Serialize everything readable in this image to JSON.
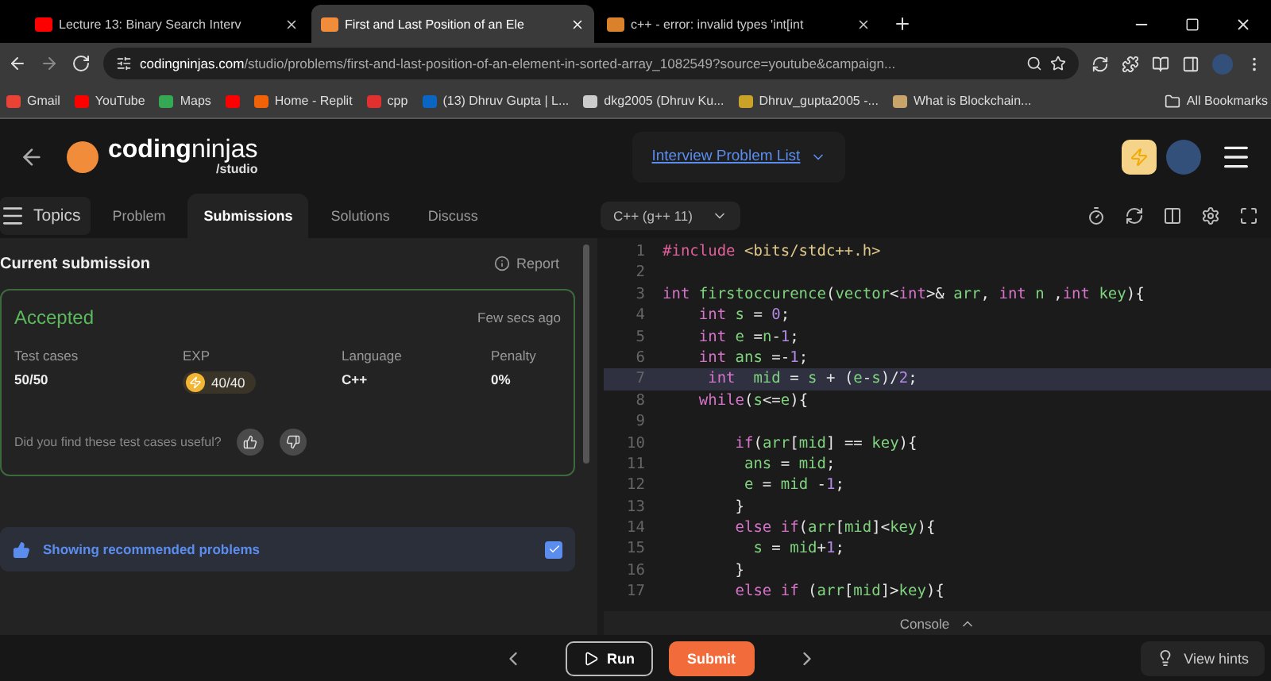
{
  "browser": {
    "tabs": [
      {
        "title": "Lecture 13: Binary Search Interv",
        "selected": false
      },
      {
        "title": "First and Last Position of an Ele",
        "selected": true
      },
      {
        "title": "c++ - error: invalid types 'int[int",
        "selected": false
      }
    ],
    "url_domain": "codingninjas.com",
    "url_path": "/studio/problems/first-and-last-position-of-an-element-in-sorted-array_1082549?source=youtube&campaign...",
    "bookmarks": [
      {
        "kind": "labeled",
        "label": "Gmail"
      },
      {
        "kind": "labeled",
        "label": "YouTube"
      },
      {
        "kind": "labeled",
        "label": "Maps"
      },
      {
        "kind": "icon"
      },
      {
        "kind": "labeled",
        "label": "Home - Replit"
      },
      {
        "kind": "labeled",
        "label": "cpp"
      },
      {
        "kind": "labeled",
        "label": "(13) Dhruv Gupta | L..."
      },
      {
        "kind": "labeled",
        "label": "dkg2005 (Dhruv Ku..."
      },
      {
        "kind": "labeled",
        "label": "Dhruv_gupta2005 -..."
      },
      {
        "kind": "labeled",
        "label": "What is Blockchain..."
      }
    ],
    "all_bookmarks": "All Bookmarks"
  },
  "header": {
    "logo_bold": "coding",
    "logo_light": "ninjas",
    "logo_sub": "/studio",
    "problem_list": "Interview Problem List"
  },
  "nav": {
    "topics": "Topics",
    "tabs": [
      {
        "label": "Problem",
        "selected": false
      },
      {
        "label": "Submissions",
        "selected": true
      },
      {
        "label": "Solutions",
        "selected": false
      },
      {
        "label": "Discuss",
        "selected": false
      }
    ]
  },
  "submission": {
    "title": "Current submission",
    "report": "Report",
    "status": "Accepted",
    "time": "Few secs ago",
    "stats": [
      {
        "label": "Test cases",
        "value": "50/50",
        "kind": "text"
      },
      {
        "label": "EXP",
        "value": "40/40",
        "kind": "exp"
      },
      {
        "label": "Language",
        "value": "C++",
        "kind": "text"
      },
      {
        "label": "Penalty",
        "value": "0%",
        "kind": "text"
      }
    ],
    "feedback": "Did you find these test cases useful?"
  },
  "recommended": {
    "label": "Showing recommended problems",
    "checked": true
  },
  "editor": {
    "language": "C++ (g++ 11)",
    "lines": [
      {
        "n": "1",
        "highlighted": false,
        "tokens": [
          {
            "kind": "pre",
            "text": "#include "
          },
          {
            "kind": "str",
            "text": "<bits/stdc++.h>"
          }
        ]
      },
      {
        "n": "2",
        "highlighted": false
      },
      {
        "n": "3",
        "highlighted": false,
        "tokens": [
          {
            "kind": "kw",
            "text": "int "
          },
          {
            "kind": "id",
            "text": "firstoccurence"
          },
          {
            "kind": "p",
            "text": "("
          },
          {
            "kind": "id",
            "text": "vector"
          },
          {
            "kind": "p",
            "text": "<"
          },
          {
            "kind": "kw",
            "text": "int"
          },
          {
            "kind": "p",
            "text": ">& "
          },
          {
            "kind": "id",
            "text": "arr"
          },
          {
            "kind": "p",
            "text": ", "
          },
          {
            "kind": "kw",
            "text": "int "
          },
          {
            "kind": "id",
            "text": "n "
          },
          {
            "kind": "p",
            "text": ","
          },
          {
            "kind": "kw",
            "text": "int "
          },
          {
            "kind": "id",
            "text": "key"
          },
          {
            "kind": "p",
            "text": "){"
          }
        ]
      },
      {
        "n": "4",
        "highlighted": false,
        "tokens": [
          {
            "kind": "kw",
            "text": "    int "
          },
          {
            "kind": "id",
            "text": "s "
          },
          {
            "kind": "p",
            "text": "= "
          },
          {
            "kind": "num",
            "text": "0"
          },
          {
            "kind": "p",
            "text": ";"
          }
        ]
      },
      {
        "n": "5",
        "highlighted": false,
        "tokens": [
          {
            "kind": "kw",
            "text": "    int "
          },
          {
            "kind": "id",
            "text": "e "
          },
          {
            "kind": "p",
            "text": "="
          },
          {
            "kind": "id",
            "text": "n"
          },
          {
            "kind": "p",
            "text": "-"
          },
          {
            "kind": "num",
            "text": "1"
          },
          {
            "kind": "p",
            "text": ";"
          }
        ]
      },
      {
        "n": "6",
        "highlighted": false,
        "tokens": [
          {
            "kind": "kw",
            "text": "    int "
          },
          {
            "kind": "id",
            "text": "ans "
          },
          {
            "kind": "p",
            "text": "=-"
          },
          {
            "kind": "num",
            "text": "1"
          },
          {
            "kind": "p",
            "text": ";"
          }
        ]
      },
      {
        "n": "7",
        "highlighted": true,
        "tokens": [
          {
            "kind": "kw",
            "text": "     int  "
          },
          {
            "kind": "id",
            "text": "mid "
          },
          {
            "kind": "p",
            "text": "= "
          },
          {
            "kind": "id",
            "text": "s "
          },
          {
            "kind": "p",
            "text": "+ ("
          },
          {
            "kind": "id",
            "text": "e"
          },
          {
            "kind": "p",
            "text": "-"
          },
          {
            "kind": "id",
            "text": "s"
          },
          {
            "kind": "p",
            "text": ")/"
          },
          {
            "kind": "num",
            "text": "2"
          },
          {
            "kind": "p",
            "text": ";"
          }
        ]
      },
      {
        "n": "8",
        "highlighted": false,
        "tokens": [
          {
            "kind": "kw",
            "text": "    while"
          },
          {
            "kind": "p",
            "text": "("
          },
          {
            "kind": "id",
            "text": "s"
          },
          {
            "kind": "p",
            "text": "<="
          },
          {
            "kind": "id",
            "text": "e"
          },
          {
            "kind": "p",
            "text": "){"
          }
        ]
      },
      {
        "n": "9",
        "highlighted": false
      },
      {
        "n": "10",
        "highlighted": false,
        "tokens": [
          {
            "kind": "kw",
            "text": "        if"
          },
          {
            "kind": "p",
            "text": "("
          },
          {
            "kind": "id",
            "text": "arr"
          },
          {
            "kind": "p",
            "text": "["
          },
          {
            "kind": "id",
            "text": "mid"
          },
          {
            "kind": "p",
            "text": "] == "
          },
          {
            "kind": "id",
            "text": "key"
          },
          {
            "kind": "p",
            "text": "){"
          }
        ]
      },
      {
        "n": "11",
        "highlighted": false,
        "tokens": [
          {
            "kind": "id",
            "text": "         ans "
          },
          {
            "kind": "p",
            "text": "= "
          },
          {
            "kind": "id",
            "text": "mid"
          },
          {
            "kind": "p",
            "text": ";"
          }
        ]
      },
      {
        "n": "12",
        "highlighted": false,
        "tokens": [
          {
            "kind": "id",
            "text": "         e "
          },
          {
            "kind": "p",
            "text": "= "
          },
          {
            "kind": "id",
            "text": "mid "
          },
          {
            "kind": "p",
            "text": "-"
          },
          {
            "kind": "num",
            "text": "1"
          },
          {
            "kind": "p",
            "text": ";"
          }
        ]
      },
      {
        "n": "13",
        "highlighted": false,
        "tokens": [
          {
            "kind": "p",
            "text": "        }"
          }
        ]
      },
      {
        "n": "14",
        "highlighted": false,
        "tokens": [
          {
            "kind": "kw",
            "text": "        else if"
          },
          {
            "kind": "p",
            "text": "("
          },
          {
            "kind": "id",
            "text": "arr"
          },
          {
            "kind": "p",
            "text": "["
          },
          {
            "kind": "id",
            "text": "mid"
          },
          {
            "kind": "p",
            "text": "]<"
          },
          {
            "kind": "id",
            "text": "key"
          },
          {
            "kind": "p",
            "text": "){"
          }
        ]
      },
      {
        "n": "15",
        "highlighted": false,
        "tokens": [
          {
            "kind": "id",
            "text": "          s "
          },
          {
            "kind": "p",
            "text": "= "
          },
          {
            "kind": "id",
            "text": "mid"
          },
          {
            "kind": "p",
            "text": "+"
          },
          {
            "kind": "num",
            "text": "1"
          },
          {
            "kind": "p",
            "text": ";"
          }
        ]
      },
      {
        "n": "16",
        "highlighted": false,
        "tokens": [
          {
            "kind": "p",
            "text": "        }"
          }
        ]
      },
      {
        "n": "17",
        "highlighted": false,
        "tokens": [
          {
            "kind": "kw",
            "text": "        else if "
          },
          {
            "kind": "p",
            "text": "("
          },
          {
            "kind": "id",
            "text": "arr"
          },
          {
            "kind": "p",
            "text": "["
          },
          {
            "kind": "id",
            "text": "mid"
          },
          {
            "kind": "p",
            "text": "]>"
          },
          {
            "kind": "id",
            "text": "key"
          },
          {
            "kind": "p",
            "text": "){"
          }
        ]
      }
    ],
    "console": "Console"
  },
  "footer": {
    "run": "Run",
    "submit": "Submit",
    "hints": "View hints"
  }
}
